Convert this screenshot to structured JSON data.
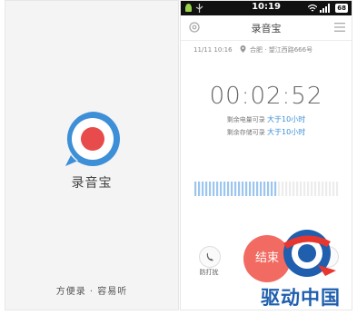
{
  "splash": {
    "app_name": "录音宝",
    "tagline": "方便录 · 容易听",
    "logo_color": "#3d8fd8",
    "record_dot_color": "#e84b4b"
  },
  "status_bar": {
    "time": "10:19",
    "battery": "68"
  },
  "titlebar": {
    "title": "录音宝",
    "left_icon": "gear-icon",
    "right_icon": "menu-icon"
  },
  "recording": {
    "date": "11/11 10:16",
    "location": "合肥 · 望江西路666号",
    "timer": "00:02:52",
    "battery_remaining_label": "剩余电量可录",
    "battery_remaining_value": "大于10小时",
    "storage_remaining_label": "剩余存储可录",
    "storage_remaining_value": "大于10小时",
    "level_active_bars": 23,
    "level_total_bars": 40
  },
  "controls": {
    "noise_label": "防打扰",
    "finish_label": "结束",
    "finish_color": "#f26b62"
  },
  "watermark": {
    "text": "驱动中国"
  },
  "colors": {
    "accent": "#3d8fd8",
    "bar_active": "#9dc6ef",
    "bar_inactive": "#ececec"
  }
}
